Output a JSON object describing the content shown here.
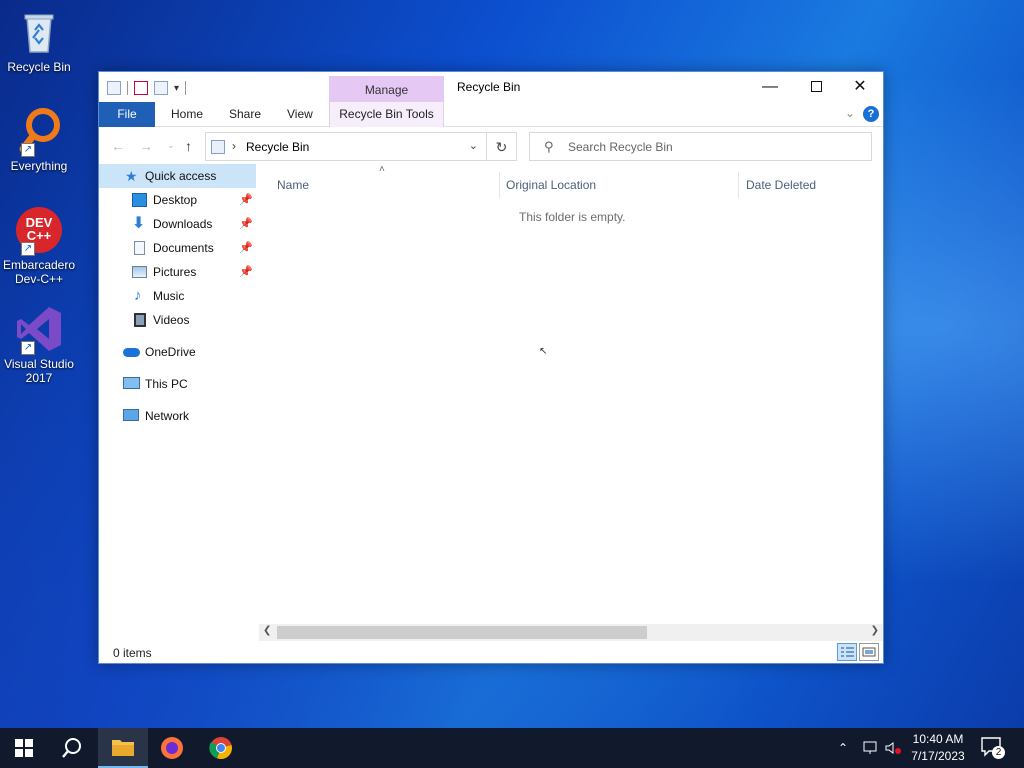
{
  "desktop": {
    "icons": [
      {
        "label": "Recycle Bin"
      },
      {
        "label": "Everything"
      },
      {
        "label": "Embarcadero Dev-C++",
        "logo_text": "DEV C++"
      },
      {
        "label": "Visual Studio 2017"
      }
    ]
  },
  "window": {
    "title": "Recycle Bin",
    "contextual_tab_group": "Manage",
    "ribbon_tabs": [
      "File",
      "Home",
      "Share",
      "View",
      "Recycle Bin Tools"
    ],
    "address": {
      "path": "Recycle Bin"
    },
    "search": {
      "placeholder": "Search Recycle Bin"
    },
    "sidebar": {
      "quick_access": "Quick access",
      "items": [
        {
          "label": "Desktop",
          "pinned": true
        },
        {
          "label": "Downloads",
          "pinned": true
        },
        {
          "label": "Documents",
          "pinned": true
        },
        {
          "label": "Pictures",
          "pinned": true
        },
        {
          "label": "Music",
          "pinned": false
        },
        {
          "label": "Videos",
          "pinned": false
        }
      ],
      "onedrive": "OneDrive",
      "this_pc": "This PC",
      "network": "Network"
    },
    "columns": [
      "Name",
      "Original Location",
      "Date Deleted"
    ],
    "empty_message": "This folder is empty.",
    "status": {
      "item_count": "0 items"
    }
  },
  "taskbar": {
    "time": "10:40 AM",
    "date": "7/17/2023",
    "notification_count": "2"
  },
  "colors": {
    "file_tab": "#1f5fb5",
    "manage_tab": "#e6c8f5",
    "selection": "#cce4f7",
    "taskbar": "#101a2c"
  }
}
